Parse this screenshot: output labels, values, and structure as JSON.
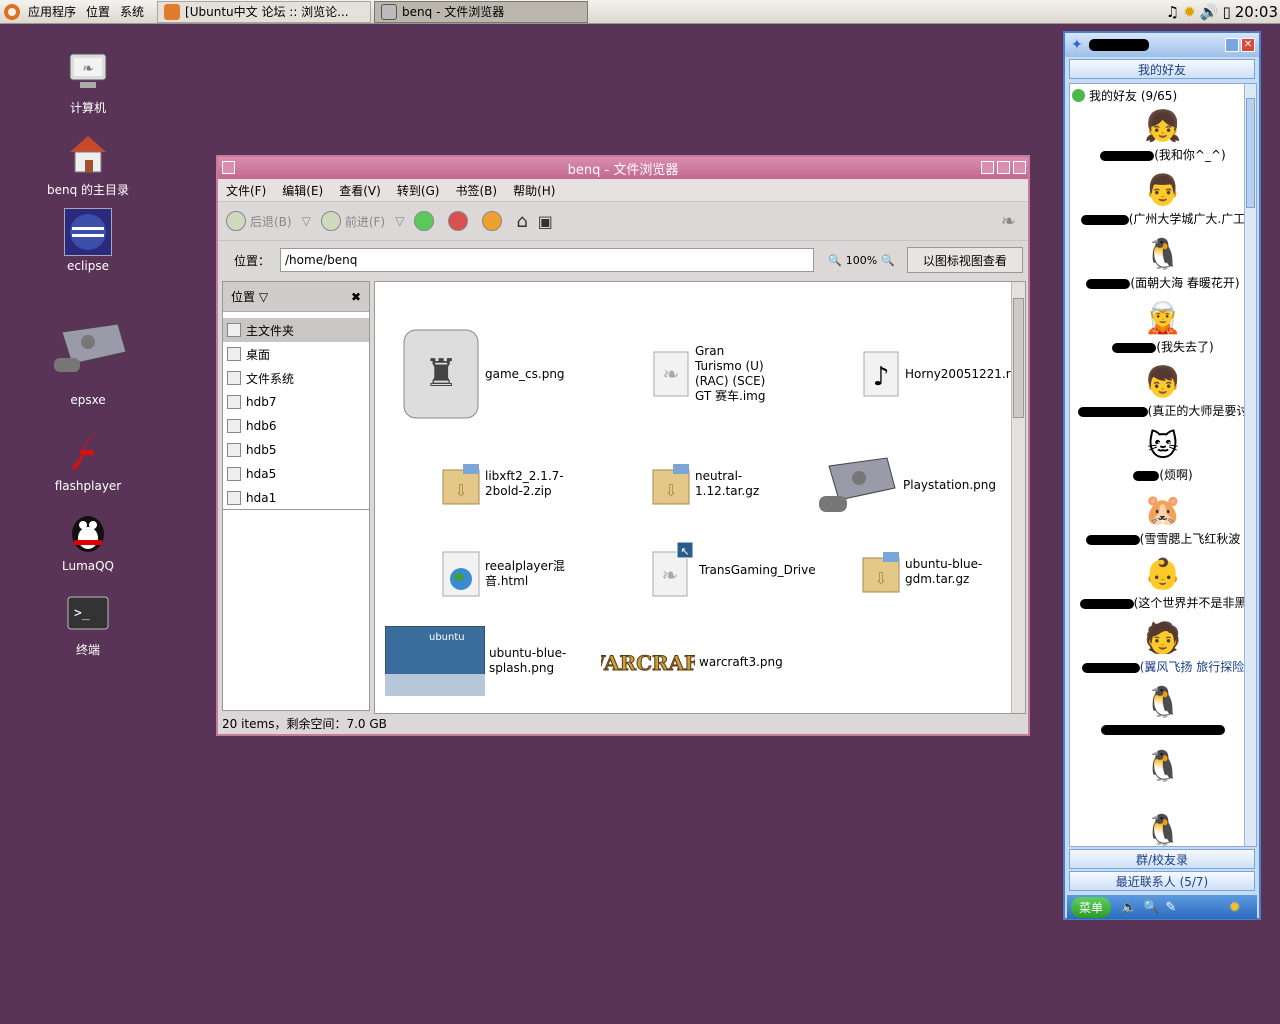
{
  "topbar": {
    "menus": [
      "应用程序",
      "位置",
      "系统"
    ],
    "tasks": [
      {
        "label": "[Ubuntu中文 论坛 :: 浏览论...",
        "active": false
      },
      {
        "label": "benq - 文件浏览器",
        "active": true
      }
    ],
    "clock": "20:03"
  },
  "desktop_icons": [
    {
      "label": "计算机",
      "icon": "computer-icon"
    },
    {
      "label": "benq 的主目录",
      "icon": "home-icon"
    },
    {
      "label": "eclipse",
      "icon": "eclipse-icon"
    },
    {
      "label": "epsxe",
      "icon": "playstation-icon"
    },
    {
      "label": "flashplayer",
      "icon": "flash-icon"
    },
    {
      "label": "LumaQQ",
      "icon": "qq-penguin-icon"
    },
    {
      "label": "终端",
      "icon": "terminal-icon"
    }
  ],
  "file_manager": {
    "title": "benq - 文件浏览器",
    "menu": [
      "文件(F)",
      "编辑(E)",
      "查看(V)",
      "转到(G)",
      "书签(B)",
      "帮助(H)"
    ],
    "toolbar": {
      "back": "后退(B)",
      "forward": "前进(F)"
    },
    "location_label": "位置：",
    "location_value": "/home/benq",
    "zoom": "100%",
    "view_mode": "以图标视图查看",
    "sidebar_title": "位置",
    "sidebar_items": [
      "主文件夹",
      "桌面",
      "文件系统",
      "hdb7",
      "hdb6",
      "hdb5",
      "hda5",
      "hda1"
    ],
    "files": [
      {
        "name": "game_cs.png",
        "icon": "cs-image-icon"
      },
      {
        "name": "Gran Turismo (U) (RAC) (SCE) GT 赛车.img",
        "icon": "gnome-foot-icon"
      },
      {
        "name": "Horny20051221.rm",
        "icon": "audio-icon"
      },
      {
        "name": "libxft2_2.1.7-2bold-2.zip",
        "icon": "zip-icon"
      },
      {
        "name": "neutral-1.12.tar.gz",
        "icon": "tgz-icon"
      },
      {
        "name": "Playstation.png",
        "icon": "playstation-icon"
      },
      {
        "name": "reealplayer混音.html",
        "icon": "html-icon"
      },
      {
        "name": "TransGaming_Drive",
        "icon": "gnome-foot-link-icon"
      },
      {
        "name": "ubuntu-blue-gdm.tar.gz",
        "icon": "tgz-icon"
      },
      {
        "name": "ubuntu-blue-splash.png",
        "icon": "ubuntu-splash-icon"
      },
      {
        "name": "warcraft3.png",
        "icon": "warcraft-icon"
      }
    ],
    "status": "20 items，剩余空间：7.0 GB"
  },
  "qq": {
    "tab_friends": "我的好友",
    "group_title": "我的好友 (9/65)",
    "friends": [
      {
        "nick": "(我和你^_^)",
        "avatar": "girl-avatar"
      },
      {
        "nick": "(广州大学城广大.广工",
        "avatar": "chef-avatar"
      },
      {
        "nick": "(面朝大海 春暖花开)",
        "avatar": "penguin-avatar"
      },
      {
        "nick": "(我失去了)",
        "avatar": "green-hair-avatar"
      },
      {
        "nick": "(真正的大师是要讨",
        "avatar": "boy-avatar"
      },
      {
        "nick": "(烦啊)",
        "avatar": "cat-avatar"
      },
      {
        "nick": "(雪雪腮上飞红秋波",
        "avatar": "bear-avatar"
      },
      {
        "nick": "(这个世界并不是非黑",
        "avatar": "cartoon-avatar"
      },
      {
        "nick": "(翼风飞扬 旅行探险",
        "avatar": "purple-avatar"
      },
      {
        "nick": "",
        "avatar": "penguin-gray-avatar"
      },
      {
        "nick": "",
        "avatar": "penguin-gray-avatar"
      },
      {
        "nick": "",
        "avatar": "penguin-gray-avatar"
      }
    ],
    "tab_groups": "群/校友录",
    "tab_recent": "最近联系人 (5/7)",
    "menu_button": "菜单",
    "colors": {
      "accent": "#4b80c8",
      "highlight": "#1b3e86"
    }
  }
}
